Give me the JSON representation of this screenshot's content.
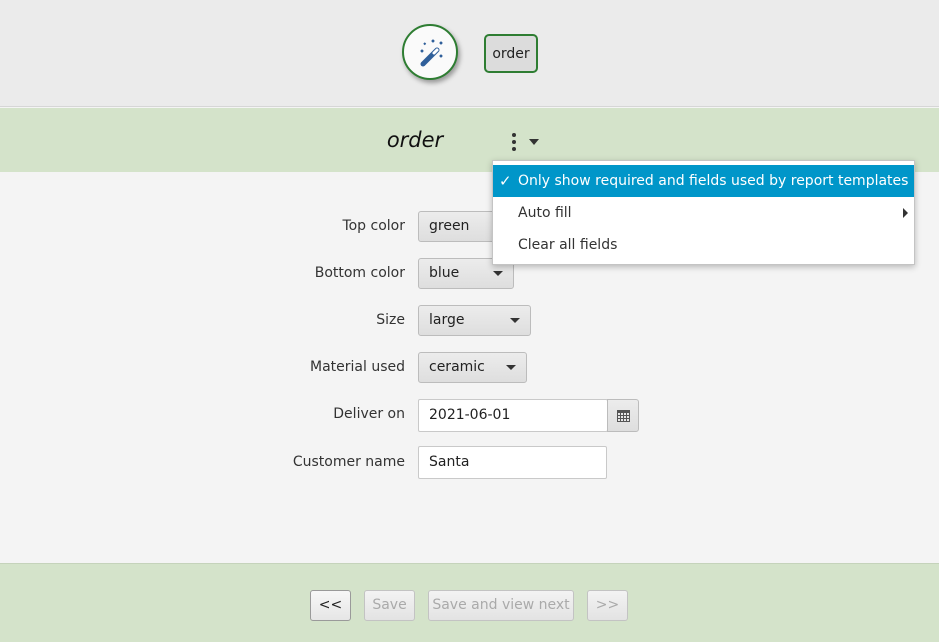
{
  "toolbar": {
    "wand_icon": "magic-wand-icon",
    "tag_label": "order"
  },
  "form": {
    "title": "order",
    "fields": {
      "top_color": {
        "label": "Top color",
        "value": "green"
      },
      "bottom_color": {
        "label": "Bottom color",
        "value": "blue"
      },
      "size": {
        "label": "Size",
        "value": "large"
      },
      "material": {
        "label": "Material used",
        "value": "ceramic"
      },
      "deliver_on": {
        "label": "Deliver on",
        "value": "2021-06-01"
      },
      "customer_name": {
        "label": "Customer name",
        "value": "Santa"
      }
    }
  },
  "menu": {
    "items": [
      {
        "label": "Only show required and fields used by report templates",
        "checked": true
      },
      {
        "label": "Auto fill",
        "has_submenu": true
      },
      {
        "label": "Clear all fields"
      }
    ],
    "check_glyph": "✓"
  },
  "footer": {
    "prev_label": "<<",
    "save_label": "Save",
    "save_next_label": "Save and view next",
    "next_label": ">>"
  },
  "colors": {
    "accent_green": "#2e7d32",
    "band_green": "#d4e3ca",
    "menu_selected": "#0096c9"
  }
}
